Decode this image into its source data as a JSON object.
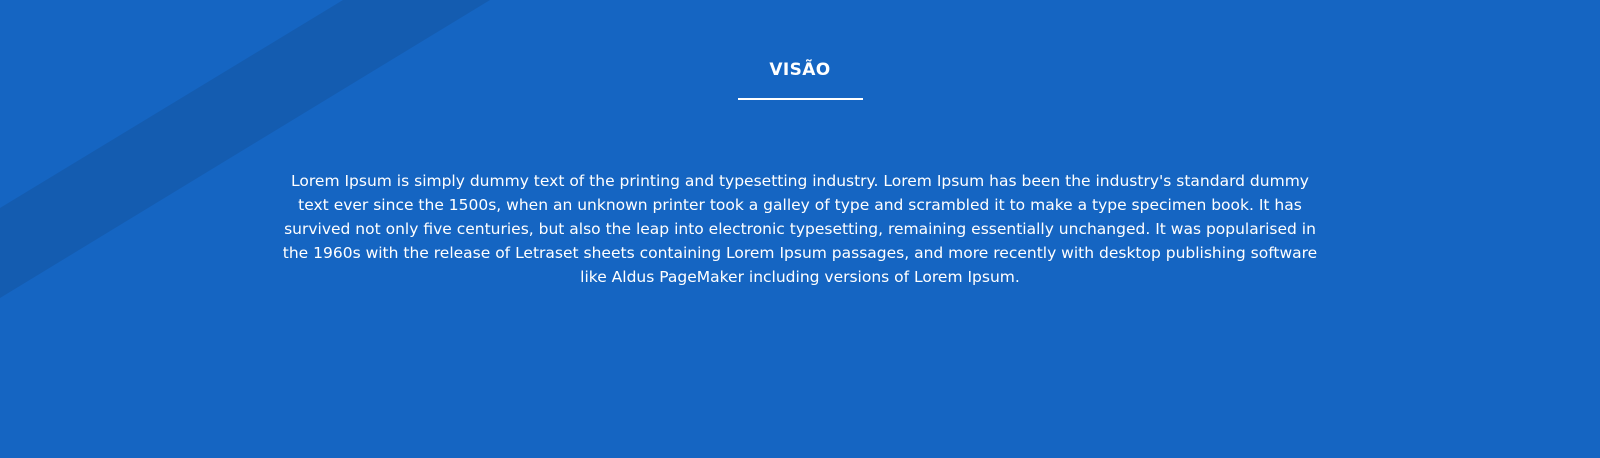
{
  "theme": {
    "background_color": "#1565c2",
    "band_color": "#145cb0",
    "text_color": "#ffffff"
  },
  "section": {
    "title": "VISÃO",
    "body": "Lorem Ipsum is simply dummy text of the printing and typesetting industry. Lorem Ipsum has been the industry's standard dummy text ever since the 1500s, when an unknown printer took a galley of type and scrambled it to make a type specimen book. It has survived not only five centuries, but also the leap into electronic typesetting, remaining essentially unchanged. It was popularised in the 1960s with the release of Letraset sheets containing Lorem Ipsum passages, and more recently with desktop publishing software like Aldus PageMaker including versions of Lorem Ipsum."
  }
}
